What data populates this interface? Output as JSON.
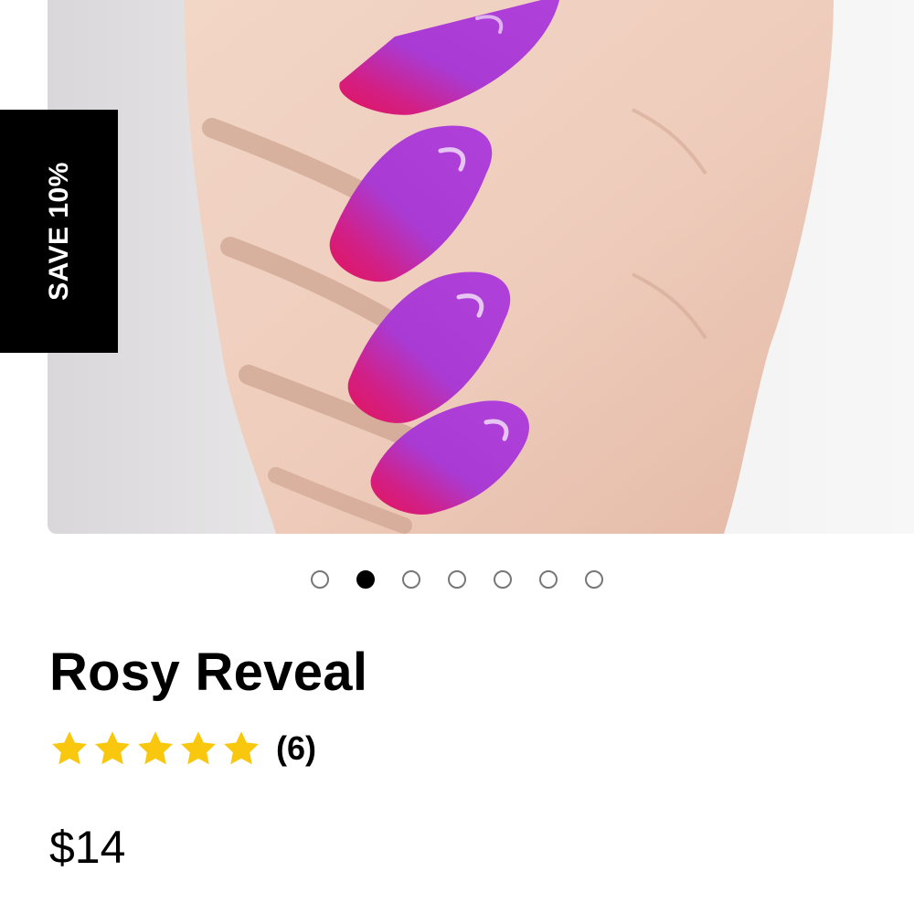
{
  "product": {
    "title": "Rosy Reveal",
    "rating_value": 5,
    "rating_max": 5,
    "review_count": "(6)",
    "price": "$14",
    "badge_label": "SAVE 10%"
  },
  "gallery": {
    "image_description": "hand with purple-to-pink ombre coffin nails",
    "slide_count": 7,
    "active_slide": 2
  },
  "colors": {
    "star": "#f9c80e",
    "badge_bg": "#000000",
    "nail_top": "#a83ad6",
    "nail_tip": "#e0155f"
  }
}
